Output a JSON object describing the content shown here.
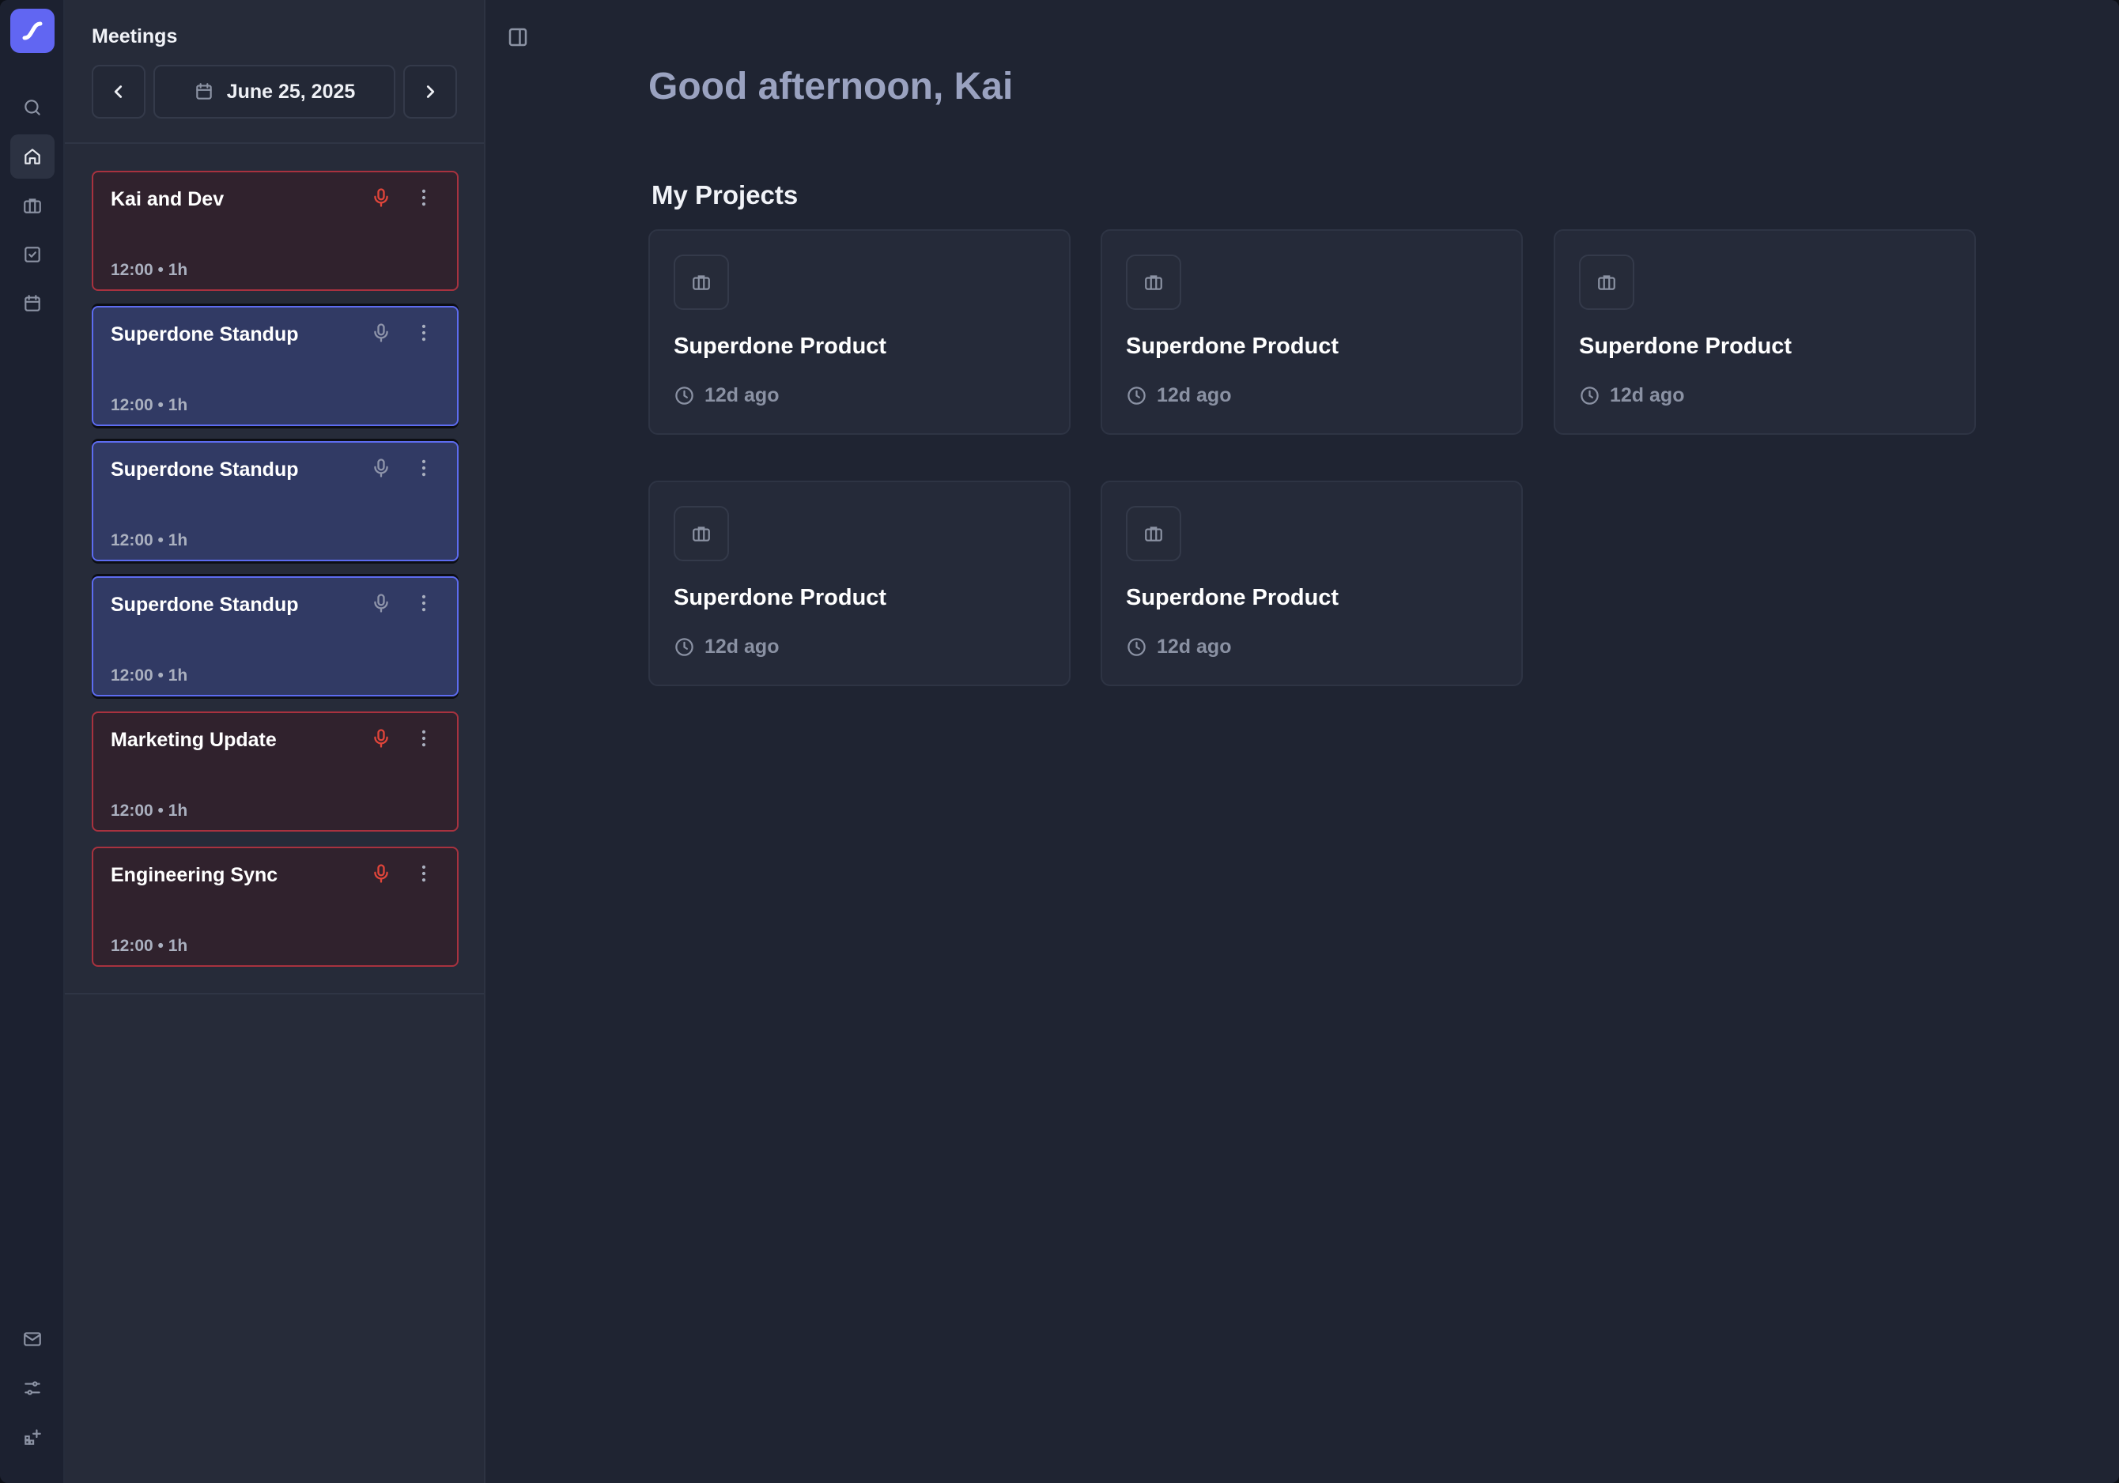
{
  "rail": {
    "items": [
      {
        "icon": "search-icon",
        "active": false
      },
      {
        "icon": "home-icon",
        "active": true
      },
      {
        "icon": "briefcase-icon",
        "active": false
      },
      {
        "icon": "check-square-icon",
        "active": false
      },
      {
        "icon": "calendar-icon",
        "active": false
      }
    ],
    "bottom_items": [
      {
        "icon": "mail-icon"
      },
      {
        "icon": "sliders-icon"
      },
      {
        "icon": "grid-add-icon"
      }
    ]
  },
  "meetings": {
    "title": "Meetings",
    "date": "June 25, 2025",
    "items": [
      {
        "title": "Kai and Dev",
        "time": "12:00",
        "duration": "• 1h",
        "time_label": "12:00 • 1h",
        "recording": true
      },
      {
        "title": "Superdone Standup",
        "time": "12:00",
        "duration": "• 1h",
        "time_label": "12:00 • 1h",
        "recording": false
      },
      {
        "title": "Superdone Standup",
        "time": "12:00",
        "duration": "• 1h",
        "time_label": "12:00 • 1h",
        "recording": false
      },
      {
        "title": "Superdone Standup",
        "time": "12:00",
        "duration": "• 1h",
        "time_label": "12:00 • 1h",
        "recording": false
      },
      {
        "title": "Marketing Update",
        "time": "12:00",
        "duration": "• 1h",
        "time_label": "12:00 • 1h",
        "recording": true
      },
      {
        "title": "Engineering Sync",
        "time": "12:00",
        "duration": "• 1h",
        "time_label": "12:00 • 1h",
        "recording": true
      }
    ]
  },
  "main": {
    "greeting": "Good afternoon, Kai",
    "projects_title": "My Projects",
    "projects": [
      {
        "name": "Superdone Product",
        "updated": "12d ago"
      },
      {
        "name": "Superdone Product",
        "updated": "12d ago"
      },
      {
        "name": "Superdone Product",
        "updated": "12d ago"
      },
      {
        "name": "Superdone Product",
        "updated": "12d ago"
      },
      {
        "name": "Superdone Product",
        "updated": "12d ago"
      }
    ]
  },
  "colors": {
    "accent": "#6166f2",
    "recording_red": "#e0453a",
    "recording_bg": "#30222d",
    "standup_bg": "#313a64",
    "standup_border": "#5d6cf0"
  }
}
